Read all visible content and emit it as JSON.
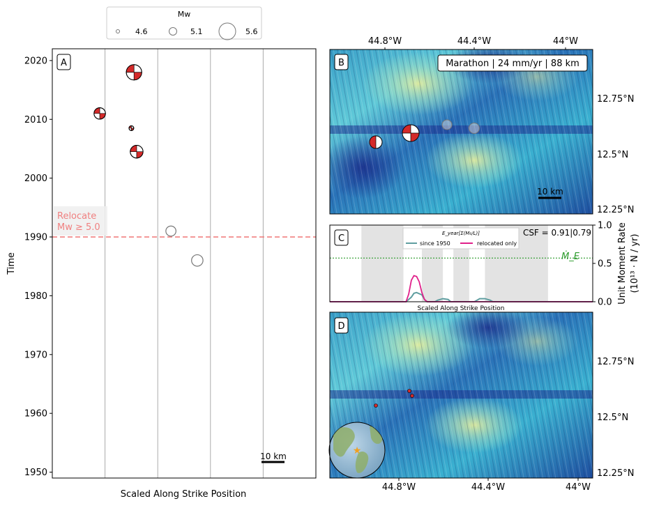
{
  "legend": {
    "title": "Mw",
    "entries": [
      {
        "label": "4.6",
        "mw": 4.6
      },
      {
        "label": "5.1",
        "mw": 5.1
      },
      {
        "label": "5.6",
        "mw": 5.6
      }
    ]
  },
  "chart_data": [
    {
      "panel": "A",
      "type": "scatter",
      "xlabel": "Scaled Along Strike Position",
      "ylabel": "Time",
      "ylim": [
        1949,
        2022
      ],
      "yticks": [
        "1950",
        "1960",
        "1970",
        "1980",
        "1990",
        "2000",
        "2010",
        "2020"
      ],
      "x_range": [
        0,
        1
      ],
      "segment_boundaries": [
        0.2,
        0.4,
        0.6,
        0.8
      ],
      "relocate_threshold": {
        "year": 1990,
        "label_line1": "Relocate",
        "label_line2": "Mw ≥ 5.0",
        "color": "#f08080"
      },
      "scale_bar": "10 km",
      "events": [
        {
          "x": 0.31,
          "year": 2018,
          "mw": 5.5,
          "style": "beachball"
        },
        {
          "x": 0.18,
          "year": 2011,
          "mw": 5.2,
          "style": "beachball"
        },
        {
          "x": 0.3,
          "year": 2008.5,
          "mw": 4.7,
          "style": "beachball"
        },
        {
          "x": 0.32,
          "year": 2004.5,
          "mw": 5.3,
          "style": "beachball"
        },
        {
          "x": 0.45,
          "year": 1991,
          "mw": 5.1,
          "style": "circle"
        },
        {
          "x": 0.55,
          "year": 1986,
          "mw": 5.2,
          "style": "circle"
        }
      ]
    },
    {
      "panel": "B",
      "type": "map",
      "label": "Marathon | 24 mm/yr | 88 km",
      "top_ticks": [
        "44.8°W",
        "44.4°W",
        "44°W"
      ],
      "right_ticks": [
        "12.75°N",
        "12.5°N",
        "12.25°N"
      ],
      "scale_bar": "10 km"
    },
    {
      "panel": "C",
      "type": "line",
      "xlabel": "Scaled Along Strike Position",
      "ylabel_line1": "Unit Moment Rate",
      "ylabel_line2": "(10¹³ · N / yr)",
      "ylim": [
        0,
        1.0
      ],
      "yticks": [
        "0.0",
        "0.5",
        "1.0"
      ],
      "legend_title": "E_year[Σ(M₀/L)]",
      "csf_label": "CSF = 0.91|0.79",
      "me_label": "Ṁ_E",
      "me_value": 0.57,
      "shaded_ranges": [
        [
          0.12,
          0.28
        ],
        [
          0.35,
          0.43
        ],
        [
          0.47,
          0.53
        ],
        [
          0.59,
          0.83
        ]
      ],
      "series": [
        {
          "name": "since 1950",
          "color": "#5f9ea0",
          "x": [
            0,
            0.29,
            0.31,
            0.32,
            0.33,
            0.35,
            0.36,
            0.37,
            0.4,
            0.41,
            0.43,
            0.45,
            0.46,
            0.55,
            0.56,
            0.57,
            0.59,
            0.61,
            0.62,
            1
          ],
          "y": [
            0,
            0,
            0.06,
            0.11,
            0.12,
            0.09,
            0.03,
            0,
            0,
            0.02,
            0.04,
            0.03,
            0,
            0,
            0.02,
            0.04,
            0.04,
            0.02,
            0,
            0
          ]
        },
        {
          "name": "relocated only",
          "color": "#e0208a",
          "x": [
            0,
            0.29,
            0.3,
            0.31,
            0.32,
            0.33,
            0.34,
            0.35,
            0.36,
            0.37,
            1
          ],
          "y": [
            0,
            0,
            0.1,
            0.28,
            0.34,
            0.33,
            0.26,
            0.12,
            0.03,
            0,
            0
          ]
        }
      ]
    },
    {
      "panel": "D",
      "type": "map",
      "bottom_ticks": [
        "44.8°W",
        "44.4°W",
        "44°W"
      ],
      "right_ticks": [
        "12.75°N",
        "12.5°N",
        "12.25°N"
      ]
    }
  ]
}
